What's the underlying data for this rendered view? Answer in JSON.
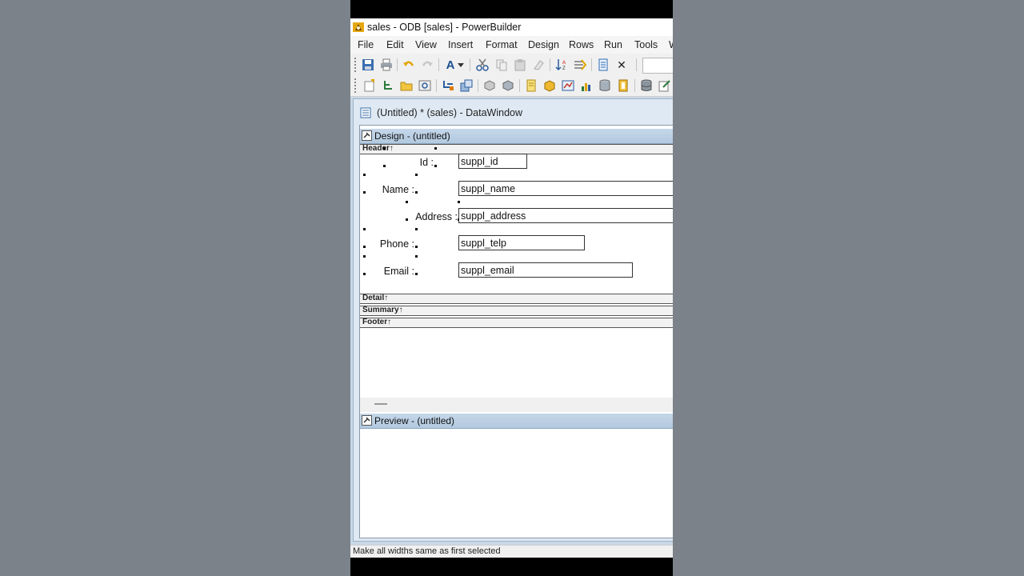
{
  "window": {
    "title": "sales - ODB [sales]  - PowerBuilder"
  },
  "menu": [
    "File",
    "Edit",
    "View",
    "Insert",
    "Format",
    "Design",
    "Rows",
    "Run",
    "Tools",
    "W"
  ],
  "toolbar1": [
    "save-icon",
    "print-icon",
    "undo-icon",
    "redo-icon",
    "font-color-icon",
    "dropdown-arrow-icon",
    "cut-icon",
    "copy-icon",
    "paste-icon",
    "clear-icon",
    "sort-icon",
    "filter-icon",
    "script-icon",
    "close-icon"
  ],
  "toolbar2": [
    "new-icon",
    "inherit-icon",
    "open-icon",
    "preview-icon",
    "layout-icon",
    "tree-icon",
    "query-icon",
    "cube-icon",
    "notes-icon",
    "package-icon",
    "report-icon",
    "graph-icon",
    "database-icon",
    "library-icon",
    "database-stack-icon",
    "edit-icon"
  ],
  "document": {
    "title": "(Untitled) * (sales) - DataWindow",
    "design_pane_title": "Design - (untitled)",
    "preview_pane_title": "Preview - (untitled)",
    "bands": {
      "header": "Header↑",
      "detail": "Detail↑",
      "summary": "Summary↑",
      "footer": "Footer↑"
    },
    "labels": {
      "id": "Id :",
      "name": "Name :",
      "address": "Address :",
      "phone": "Phone :",
      "email": "Email :"
    },
    "columns": {
      "id": "suppl_id",
      "name": "suppl_name",
      "address": "suppl_address",
      "phone": "suppl_telp",
      "email": "suppl_email"
    }
  },
  "status_bar": {
    "text": "Make all widths same as first selected"
  }
}
